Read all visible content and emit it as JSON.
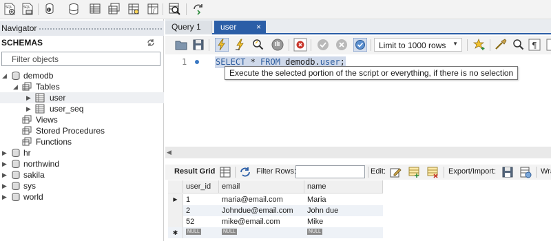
{
  "main_toolbar": {
    "icons": [
      "new-sql-tab-icon",
      "open-sql-file-icon",
      "inspector-icon",
      "create-schema-icon",
      "create-table-icon",
      "create-view-icon",
      "create-procedure-icon",
      "create-function-icon",
      "search-table-data-icon",
      "reconnect-icon"
    ]
  },
  "navigator": {
    "title": "Navigator",
    "schemas_title": "SCHEMAS",
    "filter_placeholder": "Filter objects",
    "tree": {
      "demodb": "demodb",
      "tables": "Tables",
      "user": "user",
      "user_seq": "user_seq",
      "views": "Views",
      "stored_procedures": "Stored Procedures",
      "functions": "Functions",
      "other_schemas": [
        "hr",
        "northwind",
        "sakila",
        "sys",
        "world"
      ]
    }
  },
  "tabs": [
    {
      "label": "Query 1",
      "active": false
    },
    {
      "label": "user",
      "active": true,
      "close": "×"
    }
  ],
  "editor_toolbar": {
    "limit": "Limit to 1000 rows"
  },
  "editor": {
    "line_number": "1",
    "sql": {
      "kw1": "SELECT",
      "star": " * ",
      "kw2": "FROM",
      "schema": " demodb.",
      "table": "user",
      "end": ";"
    },
    "tooltip": "Execute the selected portion of the script or everything, if there is no selection"
  },
  "result_toolbar": {
    "result_grid": "Result Grid",
    "filter_rows": "Filter Rows:",
    "edit": "Edit:",
    "export_import": "Export/Import:",
    "wrap": "Wra"
  },
  "grid": {
    "columns": [
      "user_id",
      "email",
      "name"
    ],
    "rows": [
      {
        "user_id": "1",
        "email": "maria@email.com",
        "name": "Maria"
      },
      {
        "user_id": "2",
        "email": "Johndue@email.com",
        "name": "John due"
      },
      {
        "user_id": "52",
        "email": "mike@email.com",
        "name": "Mike"
      }
    ],
    "null_label": "NULL",
    "current_row_marker": "▶",
    "new_row_marker": "✱"
  },
  "colors": {
    "accent": "#2b5ea7",
    "selection": "#cfd9ea",
    "sql_keyword": "#2c5c9e"
  }
}
